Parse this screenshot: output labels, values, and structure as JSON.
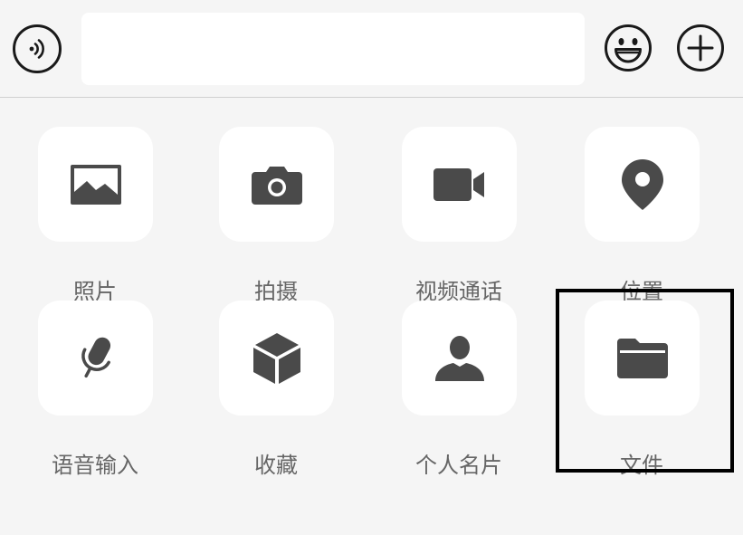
{
  "colors": {
    "background": "#f5f5f5",
    "tile": "#ffffff",
    "icon": "#4a4a4a",
    "label": "#666666",
    "highlight": "#000000"
  },
  "input_bar": {
    "voice_icon": "voice-icon",
    "text_value": "",
    "emoji_icon": "emoji-icon",
    "plus_icon": "plus-icon"
  },
  "actions": [
    {
      "label": "照片",
      "icon": "photo-icon"
    },
    {
      "label": "拍摄",
      "icon": "camera-icon"
    },
    {
      "label": "视频通话",
      "icon": "video-call-icon"
    },
    {
      "label": "位置",
      "icon": "location-icon"
    },
    {
      "label": "语音输入",
      "icon": "microphone-icon"
    },
    {
      "label": "收藏",
      "icon": "favorites-cube-icon"
    },
    {
      "label": "个人名片",
      "icon": "contact-card-icon"
    },
    {
      "label": "文件",
      "icon": "folder-icon"
    }
  ]
}
